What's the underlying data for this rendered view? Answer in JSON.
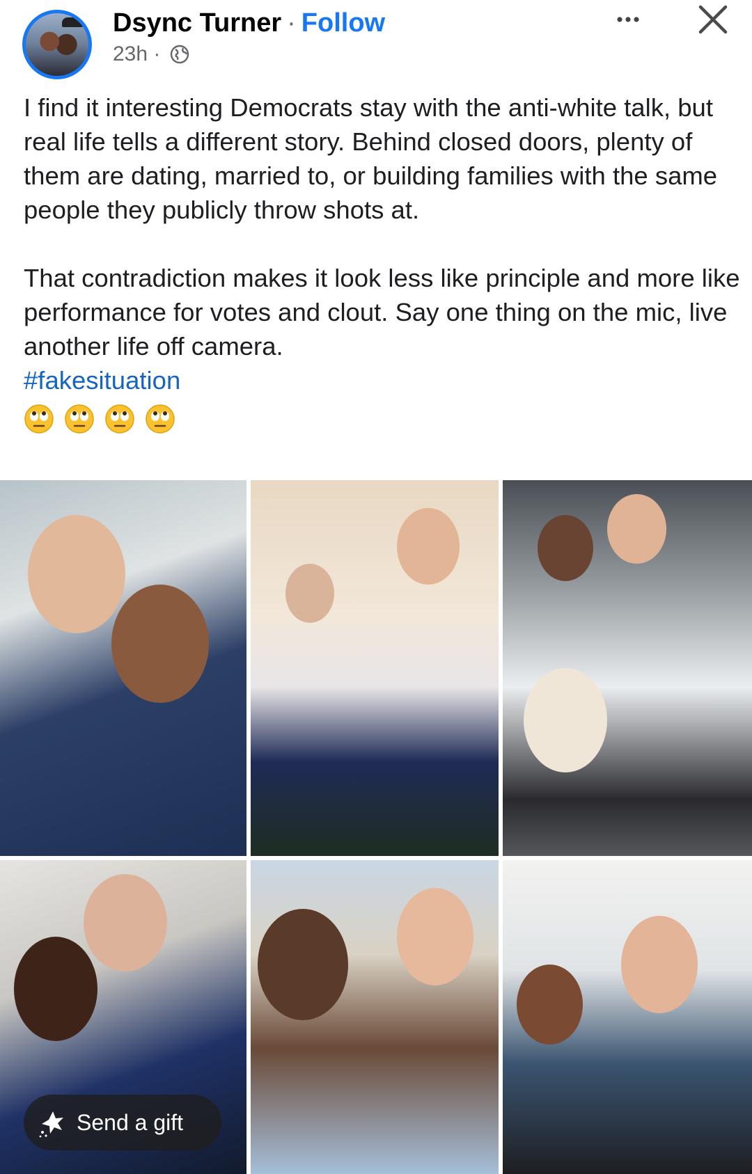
{
  "post": {
    "author": "Dsync Turner",
    "separator": "·",
    "follow_label": "Follow",
    "timestamp": "23h ·",
    "audience_icon": "globe-icon",
    "more_icon": "more-options-icon",
    "close_icon": "close-icon",
    "text_paragraph_1": "I find it interesting Democrats stay with the anti-white talk, but real life tells a different story. Behind closed doors, plenty of them are dating, married to, or building families with the same people they publicly throw shots at.",
    "text_paragraph_2": "That contradiction makes it look less like principle and more like performance for votes and clout. Say one thing on the mic, live another life off camera.",
    "hashtag": "#fakesituation",
    "emoji_count": 4,
    "emoji_icon": "face-with-rolling-eyes-icon"
  },
  "photo_grid": {
    "count": 6
  },
  "gift_button": {
    "label": "Send a gift",
    "icon": "gift-sparkle-icon"
  },
  "colors": {
    "accent": "#1877f2",
    "hashtag": "#1565c0",
    "secondary_text": "#65676b",
    "overlay_button": "#1e1e1e"
  }
}
